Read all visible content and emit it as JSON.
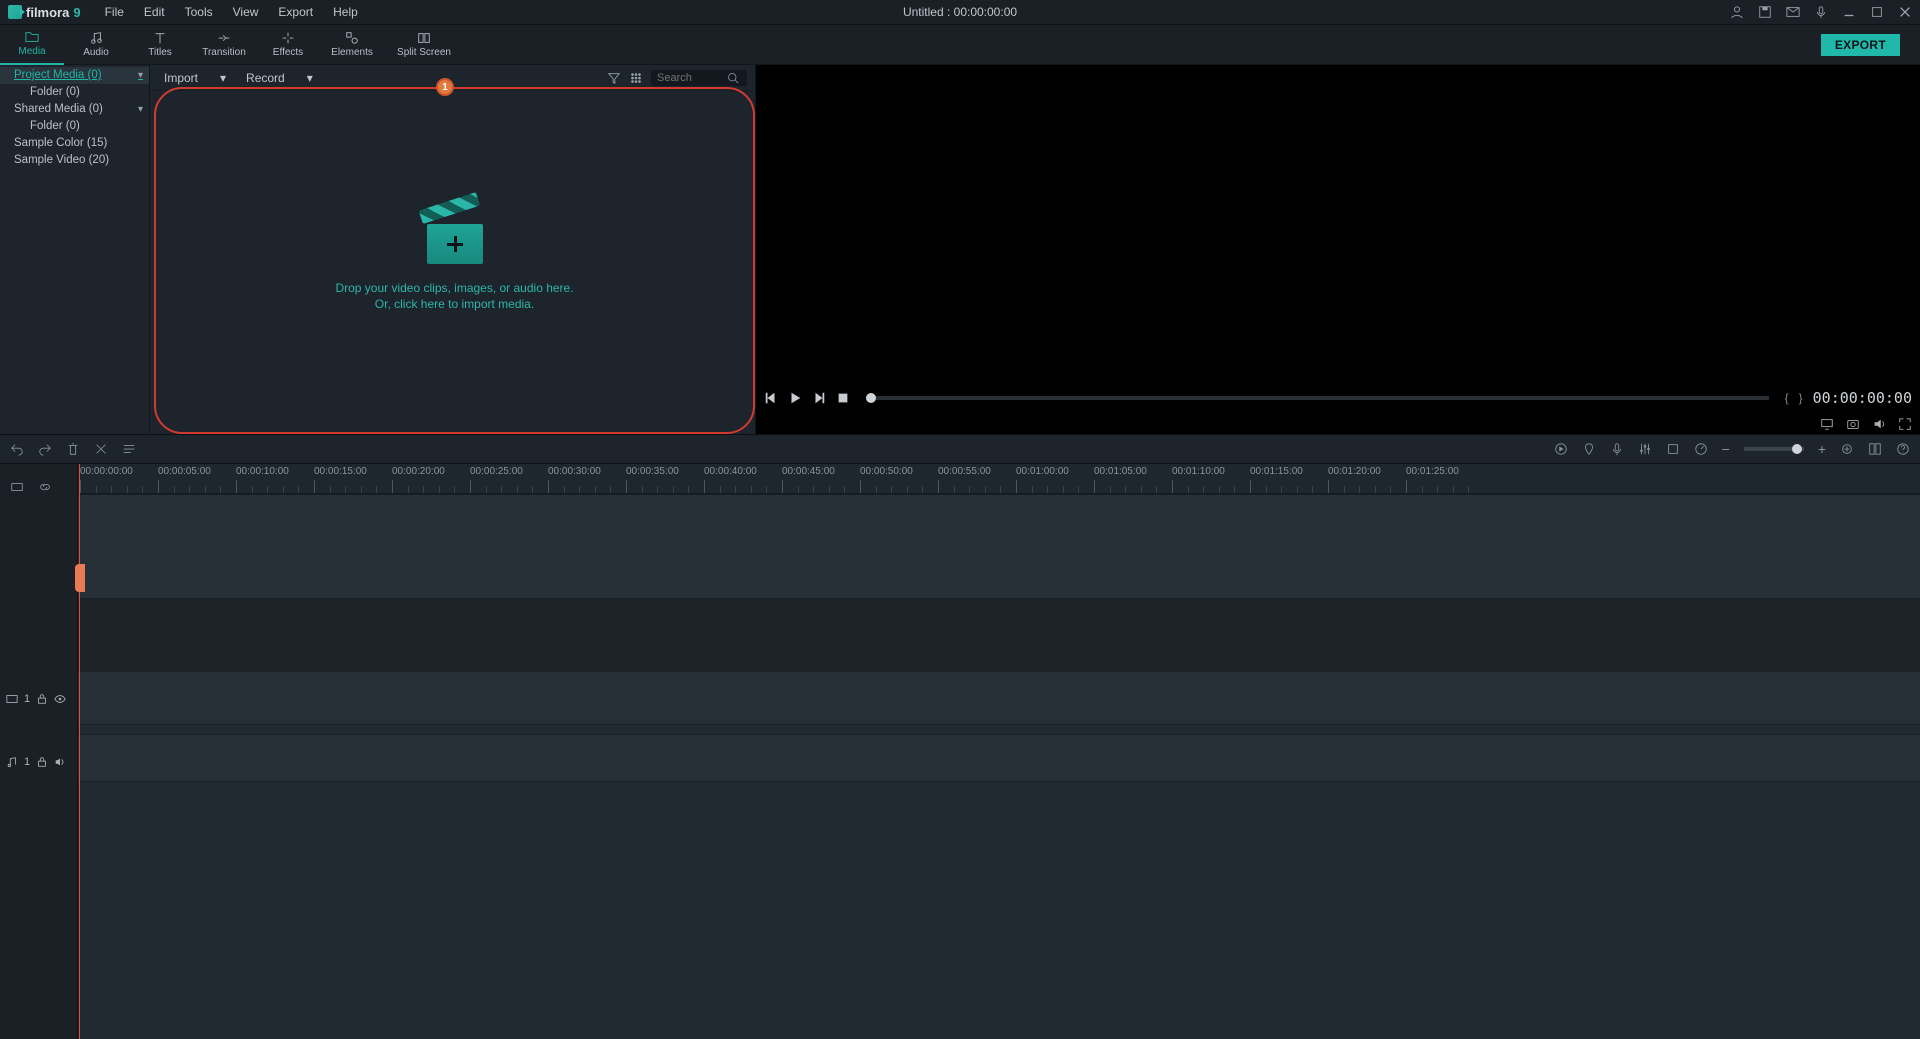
{
  "app": {
    "name": "filmora",
    "badge": "9"
  },
  "menus": [
    "File",
    "Edit",
    "Tools",
    "View",
    "Export",
    "Help"
  ],
  "title": "Untitled : 00:00:00:00",
  "tabs": [
    {
      "label": "Media",
      "active": true
    },
    {
      "label": "Audio"
    },
    {
      "label": "Titles"
    },
    {
      "label": "Transition"
    },
    {
      "label": "Effects"
    },
    {
      "label": "Elements"
    },
    {
      "label": "Split Screen"
    }
  ],
  "export_label": "EXPORT",
  "library_sidebar": [
    {
      "label": "Project Media (0)",
      "selected": true,
      "expandable": true
    },
    {
      "label": "Folder (0)",
      "indent": true
    },
    {
      "label": "Shared Media (0)",
      "expandable": true
    },
    {
      "label": "Folder (0)",
      "indent": true
    },
    {
      "label": "Sample Color (15)"
    },
    {
      "label": "Sample Video (20)"
    }
  ],
  "media_toolbar": {
    "import": "Import",
    "record": "Record",
    "search_placeholder": "Search"
  },
  "dropzone": {
    "line1": "Drop your video clips, images, or audio here.",
    "line2": "Or, click here to import media."
  },
  "highlight_badge": "1",
  "preview": {
    "timecode": "00:00:00:00"
  },
  "ruler": {
    "labels": [
      "00:00:00:00",
      "00:00:05:00",
      "00:00:10:00",
      "00:00:15:00",
      "00:00:20:00",
      "00:00:25:00",
      "00:00:30:00",
      "00:00:35:00",
      "00:00:40:00",
      "00:00:45:00",
      "00:00:50:00",
      "00:00:55:00",
      "00:01:00:00",
      "00:01:05:00",
      "00:01:10:00",
      "00:01:15:00",
      "00:01:20:00",
      "00:01:25:00"
    ],
    "spacing_px": 78
  },
  "tracks": {
    "video": {
      "id": "1"
    },
    "audio": {
      "id": "1"
    }
  }
}
